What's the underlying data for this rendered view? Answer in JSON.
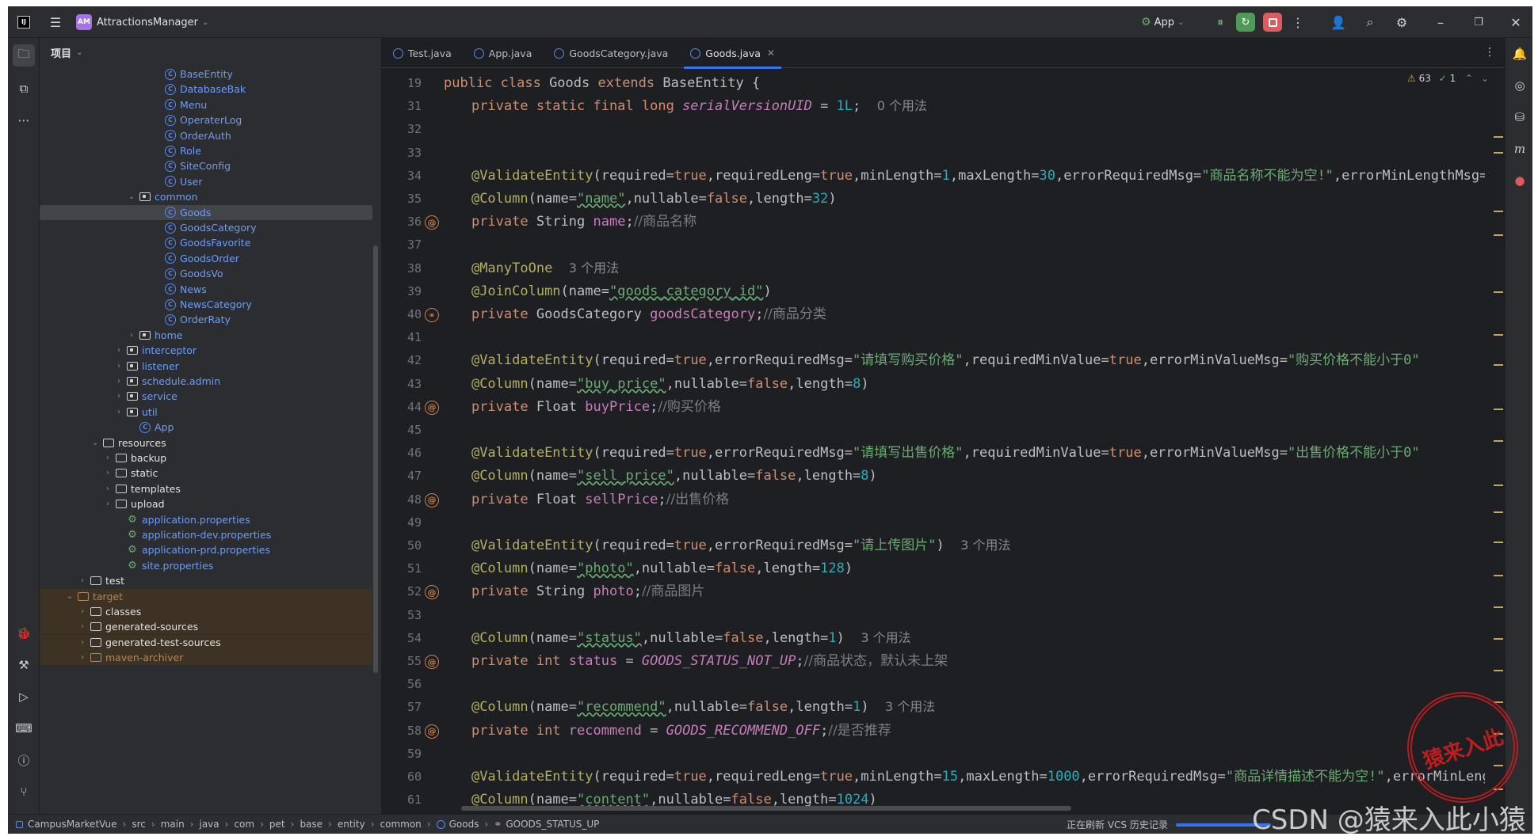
{
  "app": {
    "project_badge": "AM",
    "project_name": "AttractionsManager",
    "run_config": "App"
  },
  "project_panel": {
    "title": "项目",
    "tree": [
      {
        "label": "BaseEntity",
        "kind": "class",
        "color": "blue"
      },
      {
        "label": "DatabaseBak",
        "kind": "class",
        "color": "blue"
      },
      {
        "label": "Menu",
        "kind": "class",
        "color": "blue"
      },
      {
        "label": "OperaterLog",
        "kind": "class",
        "color": "blue"
      },
      {
        "label": "OrderAuth",
        "kind": "class",
        "color": "blue"
      },
      {
        "label": "Role",
        "kind": "class",
        "color": "blue"
      },
      {
        "label": "SiteConfig",
        "kind": "class",
        "color": "blue"
      },
      {
        "label": "User",
        "kind": "class",
        "color": "blue"
      },
      {
        "label": "common",
        "kind": "package",
        "color": "blue",
        "expanded": true
      },
      {
        "label": "Goods",
        "kind": "class",
        "color": "blue",
        "selected": true
      },
      {
        "label": "GoodsCategory",
        "kind": "class",
        "color": "blue"
      },
      {
        "label": "GoodsFavorite",
        "kind": "class",
        "color": "blue"
      },
      {
        "label": "GoodsOrder",
        "kind": "class",
        "color": "blue"
      },
      {
        "label": "GoodsVo",
        "kind": "class",
        "color": "blue"
      },
      {
        "label": "News",
        "kind": "class",
        "color": "blue"
      },
      {
        "label": "NewsCategory",
        "kind": "class",
        "color": "blue"
      },
      {
        "label": "OrderRaty",
        "kind": "class",
        "color": "blue"
      },
      {
        "label": "home",
        "kind": "package",
        "color": "blue"
      },
      {
        "label": "interceptor",
        "kind": "package",
        "color": "blue"
      },
      {
        "label": "listener",
        "kind": "package",
        "color": "blue"
      },
      {
        "label": "schedule.admin",
        "kind": "package",
        "color": "blue"
      },
      {
        "label": "service",
        "kind": "package",
        "color": "blue"
      },
      {
        "label": "util",
        "kind": "package",
        "color": "blue"
      },
      {
        "label": "App",
        "kind": "app",
        "color": "blue"
      },
      {
        "label": "resources",
        "kind": "folder",
        "color": "plain",
        "expanded": true
      },
      {
        "label": "backup",
        "kind": "folder",
        "color": "plain"
      },
      {
        "label": "static",
        "kind": "folder",
        "color": "plain"
      },
      {
        "label": "templates",
        "kind": "folder",
        "color": "plain"
      },
      {
        "label": "upload",
        "kind": "folder",
        "color": "plain"
      },
      {
        "label": "application.properties",
        "kind": "props",
        "color": "blue"
      },
      {
        "label": "application-dev.properties",
        "kind": "props",
        "color": "blue"
      },
      {
        "label": "application-prd.properties",
        "kind": "props",
        "color": "blue"
      },
      {
        "label": "site.properties",
        "kind": "props",
        "color": "blue"
      },
      {
        "label": "test",
        "kind": "folder",
        "color": "plain"
      },
      {
        "label": "target",
        "kind": "folder",
        "color": "orange",
        "expanded": true
      },
      {
        "label": "classes",
        "kind": "folder",
        "color": "plain"
      },
      {
        "label": "generated-sources",
        "kind": "folder",
        "color": "plain"
      },
      {
        "label": "generated-test-sources",
        "kind": "folder",
        "color": "plain"
      },
      {
        "label": "maven-archiver",
        "kind": "folder",
        "color": "orange"
      }
    ]
  },
  "editor": {
    "tabs": [
      {
        "label": "Test.java",
        "active": false
      },
      {
        "label": "App.java",
        "active": false
      },
      {
        "label": "GoodsCategory.java",
        "active": false
      },
      {
        "label": "Goods.java",
        "active": true
      }
    ],
    "inspections": {
      "warnings": "63",
      "ok": "1"
    },
    "line_numbers": [
      "19",
      "31",
      "32",
      "33",
      "34",
      "35",
      "36",
      "37",
      "38",
      "39",
      "40",
      "41",
      "42",
      "43",
      "44",
      "45",
      "46",
      "47",
      "48",
      "49",
      "50",
      "51",
      "52",
      "53",
      "54",
      "55",
      "56",
      "57",
      "58",
      "59",
      "60",
      "61"
    ],
    "lines": [
      [
        [
          "kw",
          "public class "
        ],
        [
          "pl",
          "Goods "
        ],
        [
          "kw",
          "extends "
        ],
        [
          "pl",
          "BaseEntity {"
        ]
      ],
      [
        [
          "pl",
          "    "
        ],
        [
          "kw",
          "private static final long "
        ],
        [
          "cst",
          "serialVersionUID"
        ],
        [
          "pl",
          " = "
        ],
        [
          "nu",
          "1L"
        ],
        [
          "pl",
          ";  "
        ],
        [
          "hint",
          "0 个用法"
        ]
      ],
      [],
      [],
      [
        [
          "pl",
          "    "
        ],
        [
          "an",
          "@ValidateEntity"
        ],
        [
          "pl",
          "(required="
        ],
        [
          "kw",
          "true"
        ],
        [
          "pl",
          ",requiredLeng="
        ],
        [
          "kw",
          "true"
        ],
        [
          "pl",
          ",minLength="
        ],
        [
          "nu",
          "1"
        ],
        [
          "pl",
          ",maxLength="
        ],
        [
          "nu",
          "30"
        ],
        [
          "pl",
          ",errorRequiredMsg="
        ],
        [
          "st",
          "\"商品名称不能为空!\""
        ],
        [
          "pl",
          ",errorMinLengthMsg="
        ]
      ],
      [
        [
          "pl",
          "    "
        ],
        [
          "an",
          "@Column"
        ],
        [
          "pl",
          "(name="
        ],
        [
          "stu",
          "\"name\""
        ],
        [
          "pl",
          ",nullable="
        ],
        [
          "kw",
          "false"
        ],
        [
          "pl",
          ",length="
        ],
        [
          "nu",
          "32"
        ],
        [
          "pl",
          ")"
        ]
      ],
      [
        [
          "pl",
          "    "
        ],
        [
          "kw",
          "private "
        ],
        [
          "pl",
          "String "
        ],
        [
          "fd",
          "name"
        ],
        [
          "pl",
          ";"
        ],
        [
          "cm",
          "//商品名称"
        ]
      ],
      [],
      [
        [
          "pl",
          "    "
        ],
        [
          "an",
          "@ManyToOne"
        ],
        [
          "pl",
          "  "
        ],
        [
          "hint",
          "3 个用法"
        ]
      ],
      [
        [
          "pl",
          "    "
        ],
        [
          "an",
          "@JoinColumn"
        ],
        [
          "pl",
          "(name="
        ],
        [
          "stu",
          "\"goods_category_id\""
        ],
        [
          "pl",
          ")"
        ]
      ],
      [
        [
          "pl",
          "    "
        ],
        [
          "kw",
          "private "
        ],
        [
          "pl",
          "GoodsCategory "
        ],
        [
          "fd",
          "goodsCategory"
        ],
        [
          "pl",
          ";"
        ],
        [
          "cm",
          "//商品分类"
        ]
      ],
      [],
      [
        [
          "pl",
          "    "
        ],
        [
          "an",
          "@ValidateEntity"
        ],
        [
          "pl",
          "(required="
        ],
        [
          "kw",
          "true"
        ],
        [
          "pl",
          ",errorRequiredMsg="
        ],
        [
          "st",
          "\"请填写购买价格\""
        ],
        [
          "pl",
          ",requiredMinValue="
        ],
        [
          "kw",
          "true"
        ],
        [
          "pl",
          ",errorMinValueMsg="
        ],
        [
          "st",
          "\"购买价格不能小于0\""
        ]
      ],
      [
        [
          "pl",
          "    "
        ],
        [
          "an",
          "@Column"
        ],
        [
          "pl",
          "(name="
        ],
        [
          "stu",
          "\"buy_price\""
        ],
        [
          "pl",
          ",nullable="
        ],
        [
          "kw",
          "false"
        ],
        [
          "pl",
          ",length="
        ],
        [
          "nu",
          "8"
        ],
        [
          "pl",
          ")"
        ]
      ],
      [
        [
          "pl",
          "    "
        ],
        [
          "kw",
          "private "
        ],
        [
          "pl",
          "Float "
        ],
        [
          "fd",
          "buyPrice"
        ],
        [
          "pl",
          ";"
        ],
        [
          "cm",
          "//购买价格"
        ]
      ],
      [],
      [
        [
          "pl",
          "    "
        ],
        [
          "an",
          "@ValidateEntity"
        ],
        [
          "pl",
          "(required="
        ],
        [
          "kw",
          "true"
        ],
        [
          "pl",
          ",errorRequiredMsg="
        ],
        [
          "st",
          "\"请填写出售价格\""
        ],
        [
          "pl",
          ",requiredMinValue="
        ],
        [
          "kw",
          "true"
        ],
        [
          "pl",
          ",errorMinValueMsg="
        ],
        [
          "st",
          "\"出售价格不能小于0\""
        ]
      ],
      [
        [
          "pl",
          "    "
        ],
        [
          "an",
          "@Column"
        ],
        [
          "pl",
          "(name="
        ],
        [
          "stu",
          "\"sell_price\""
        ],
        [
          "pl",
          ",nullable="
        ],
        [
          "kw",
          "false"
        ],
        [
          "pl",
          ",length="
        ],
        [
          "nu",
          "8"
        ],
        [
          "pl",
          ")"
        ]
      ],
      [
        [
          "pl",
          "    "
        ],
        [
          "kw",
          "private "
        ],
        [
          "pl",
          "Float "
        ],
        [
          "fd",
          "sellPrice"
        ],
        [
          "pl",
          ";"
        ],
        [
          "cm",
          "//出售价格"
        ]
      ],
      [],
      [
        [
          "pl",
          "    "
        ],
        [
          "an",
          "@ValidateEntity"
        ],
        [
          "pl",
          "(required="
        ],
        [
          "kw",
          "true"
        ],
        [
          "pl",
          ",errorRequiredMsg="
        ],
        [
          "st",
          "\"请上传图片\""
        ],
        [
          "pl",
          ")  "
        ],
        [
          "hint",
          "3 个用法"
        ]
      ],
      [
        [
          "pl",
          "    "
        ],
        [
          "an",
          "@Column"
        ],
        [
          "pl",
          "(name="
        ],
        [
          "stu",
          "\"photo\""
        ],
        [
          "pl",
          ",nullable="
        ],
        [
          "kw",
          "false"
        ],
        [
          "pl",
          ",length="
        ],
        [
          "nu",
          "128"
        ],
        [
          "pl",
          ")"
        ]
      ],
      [
        [
          "pl",
          "    "
        ],
        [
          "kw",
          "private "
        ],
        [
          "pl",
          "String "
        ],
        [
          "fd",
          "photo"
        ],
        [
          "pl",
          ";"
        ],
        [
          "cm",
          "//商品图片"
        ]
      ],
      [],
      [
        [
          "pl",
          "    "
        ],
        [
          "an",
          "@Column"
        ],
        [
          "pl",
          "(name="
        ],
        [
          "stu",
          "\"status\""
        ],
        [
          "pl",
          ",nullable="
        ],
        [
          "kw",
          "false"
        ],
        [
          "pl",
          ",length="
        ],
        [
          "nu",
          "1"
        ],
        [
          "pl",
          ")  "
        ],
        [
          "hint",
          "3 个用法"
        ]
      ],
      [
        [
          "pl",
          "    "
        ],
        [
          "kw",
          "private int "
        ],
        [
          "fd",
          "status"
        ],
        [
          "pl",
          " = "
        ],
        [
          "cst",
          "GOODS_STATUS_NOT_UP"
        ],
        [
          "pl",
          ";"
        ],
        [
          "cm",
          "//商品状态，默认未上架"
        ]
      ],
      [],
      [
        [
          "pl",
          "    "
        ],
        [
          "an",
          "@Column"
        ],
        [
          "pl",
          "(name="
        ],
        [
          "stu",
          "\"recommend\""
        ],
        [
          "pl",
          ",nullable="
        ],
        [
          "kw",
          "false"
        ],
        [
          "pl",
          ",length="
        ],
        [
          "nu",
          "1"
        ],
        [
          "pl",
          ")  "
        ],
        [
          "hint",
          "3 个用法"
        ]
      ],
      [
        [
          "pl",
          "    "
        ],
        [
          "kw",
          "private int "
        ],
        [
          "fd",
          "recommend"
        ],
        [
          "pl",
          " = "
        ],
        [
          "cst",
          "GOODS_RECOMMEND_OFF"
        ],
        [
          "pl",
          ";"
        ],
        [
          "cm",
          "//是否推荐"
        ]
      ],
      [],
      [
        [
          "pl",
          "    "
        ],
        [
          "an",
          "@ValidateEntity"
        ],
        [
          "pl",
          "(required="
        ],
        [
          "kw",
          "true"
        ],
        [
          "pl",
          ",requiredLeng="
        ],
        [
          "kw",
          "true"
        ],
        [
          "pl",
          ",minLength="
        ],
        [
          "nu",
          "15"
        ],
        [
          "pl",
          ",maxLength="
        ],
        [
          "nu",
          "1000"
        ],
        [
          "pl",
          ",errorRequiredMsg="
        ],
        [
          "st",
          "\"商品详情描述不能为空!\""
        ],
        [
          "pl",
          ",errorMinLengthMsg="
        ]
      ],
      [
        [
          "pl",
          "    "
        ],
        [
          "an",
          "@Column"
        ],
        [
          "pl",
          "(name="
        ],
        [
          "stu",
          "\"content\""
        ],
        [
          "pl",
          ",nullable="
        ],
        [
          "kw",
          "false"
        ],
        [
          "pl",
          ",length="
        ],
        [
          "nu",
          "1024"
        ],
        [
          "pl",
          ")"
        ]
      ]
    ],
    "gutter_marks": {
      "36": "@",
      "40": "⚭",
      "44": "@",
      "48": "@",
      "52": "@",
      "55": "@",
      "58": "@"
    }
  },
  "status_bar": {
    "breadcrumb": [
      "CampusMarketVue",
      "src",
      "main",
      "java",
      "com",
      "pet",
      "base",
      "entity",
      "common",
      "Goods",
      "GOODS_STATUS_UP"
    ],
    "task": "正在刷新 VCS 历史记录"
  },
  "watermark": "CSDN @猿来入此小猿",
  "stamp_text": "猿来入此"
}
